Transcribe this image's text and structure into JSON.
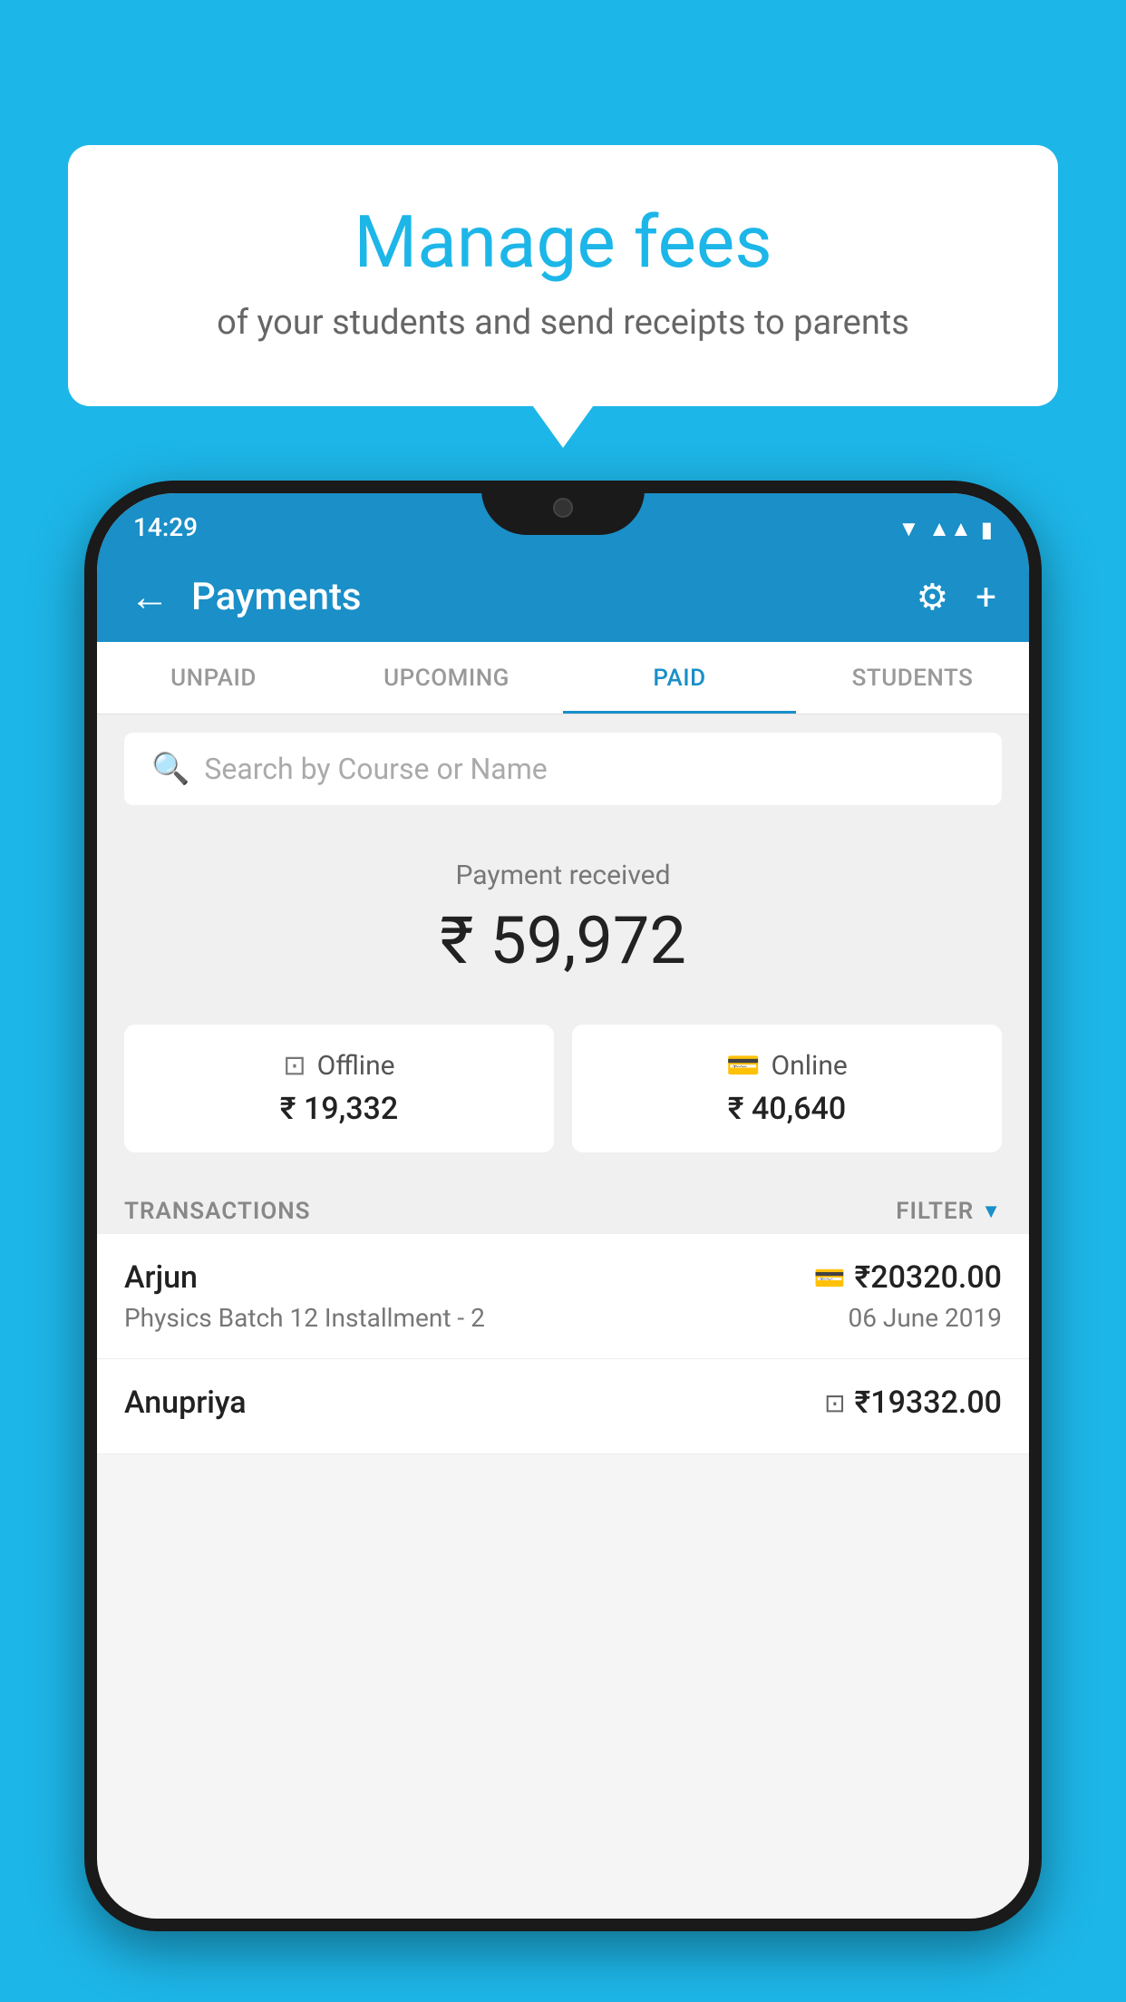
{
  "background_color": "#1db6e8",
  "speech_bubble": {
    "title": "Manage fees",
    "subtitle": "of your students and send receipts to parents"
  },
  "status_bar": {
    "time": "14:29"
  },
  "header": {
    "title": "Payments",
    "back_label": "←",
    "settings_label": "⚙",
    "add_label": "+"
  },
  "tabs": [
    {
      "label": "UNPAID",
      "active": false
    },
    {
      "label": "UPCOMING",
      "active": false
    },
    {
      "label": "PAID",
      "active": true
    },
    {
      "label": "STUDENTS",
      "active": false
    }
  ],
  "search": {
    "placeholder": "Search by Course or Name"
  },
  "payment_summary": {
    "label": "Payment received",
    "amount": "₹ 59,972"
  },
  "payment_cards": [
    {
      "type": "Offline",
      "amount": "₹ 19,332"
    },
    {
      "type": "Online",
      "amount": "₹ 40,640"
    }
  ],
  "transactions_section": {
    "label": "TRANSACTIONS",
    "filter_label": "FILTER"
  },
  "transactions": [
    {
      "name": "Arjun",
      "course": "Physics Batch 12 Installment - 2",
      "amount": "₹20320.00",
      "date": "06 June 2019",
      "payment_type": "online"
    },
    {
      "name": "Anupriya",
      "course": "",
      "amount": "₹19332.00",
      "date": "",
      "payment_type": "offline"
    }
  ]
}
